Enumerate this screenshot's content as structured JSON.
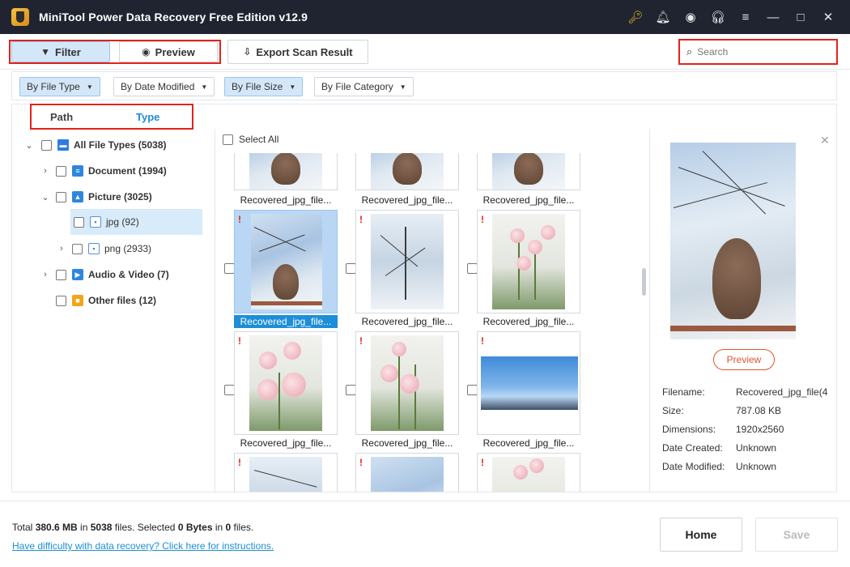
{
  "window": {
    "title": "MiniTool Power Data Recovery Free Edition v12.9",
    "controls": [
      "key-icon",
      "bell-icon",
      "disc-icon",
      "headset-icon",
      "menu-icon",
      "minimize-icon",
      "maximize-icon",
      "close-icon"
    ]
  },
  "toolbar": {
    "filter_label": "Filter",
    "preview_label": "Preview",
    "export_label": "Export Scan Result",
    "search_placeholder": "Search"
  },
  "filters": {
    "by_file_type": "By File Type",
    "by_date_modified": "By Date Modified",
    "by_file_size": "By File Size",
    "by_file_category": "By File Category"
  },
  "tabs": {
    "path": "Path",
    "type": "Type",
    "active": "Type"
  },
  "tree": {
    "items": [
      {
        "label": "All File Types (5038)",
        "icon": "monitor-icon",
        "expanded": true
      },
      {
        "label": "Document (1994)",
        "icon": "document-icon",
        "expanded": false
      },
      {
        "label": "Picture (3025)",
        "icon": "picture-icon",
        "expanded": true
      },
      {
        "label": "jpg (92)",
        "icon": "file-icon",
        "selected": true
      },
      {
        "label": "png (2933)",
        "icon": "file-icon",
        "expanded": false
      },
      {
        "label": "Audio & Video (7)",
        "icon": "video-icon",
        "expanded": false
      },
      {
        "label": "Other files (12)",
        "icon": "folder-icon"
      }
    ]
  },
  "grid": {
    "select_all_label": "Select All",
    "caption": "Recovered_jpg_file...",
    "tiles": [
      {
        "caption": "Recovered_jpg_file...",
        "image": "monkey-snow"
      },
      {
        "caption": "Recovered_jpg_file...",
        "image": "monkey-snow"
      },
      {
        "caption": "Recovered_jpg_file...",
        "image": "monkey-snow"
      },
      {
        "caption": "Recovered_jpg_file...",
        "image": "monkey-snow",
        "selected": true
      },
      {
        "caption": "Recovered_jpg_file...",
        "image": "snow-trees"
      },
      {
        "caption": "Recovered_jpg_file...",
        "image": "roses"
      },
      {
        "caption": "Recovered_jpg_file...",
        "image": "roses"
      },
      {
        "caption": "Recovered_jpg_file...",
        "image": "roses"
      },
      {
        "caption": "Recovered_jpg_file...",
        "image": "blue-sky"
      },
      {
        "caption": "",
        "image": "snow-trees"
      },
      {
        "caption": "",
        "image": "snow-ground"
      },
      {
        "caption": "",
        "image": "roses"
      }
    ]
  },
  "preview_panel": {
    "preview_button": "Preview",
    "fields": [
      {
        "label": "Filename:",
        "value": "Recovered_jpg_file(4"
      },
      {
        "label": "Size:",
        "value": "787.08 KB"
      },
      {
        "label": "Dimensions:",
        "value": "1920x2560"
      },
      {
        "label": "Date Created:",
        "value": "Unknown"
      },
      {
        "label": "Date Modified:",
        "value": "Unknown"
      }
    ]
  },
  "footer": {
    "total_prefix": "Total ",
    "total_size": "380.6 MB",
    "total_in": " in ",
    "total_files": "5038",
    "total_files_suffix": " files.  Selected ",
    "selected_size": "0 Bytes",
    "selected_in": " in ",
    "selected_files": "0",
    "selected_suffix": " files.",
    "help_link": "Have difficulty with data recovery? Click here for instructions.",
    "home_button": "Home",
    "save_button": "Save"
  },
  "colors": {
    "titlebar": "#1f2430",
    "accent": "#1d8ed8",
    "highlight": "#e2231a",
    "preview_button": "#e0552f"
  }
}
